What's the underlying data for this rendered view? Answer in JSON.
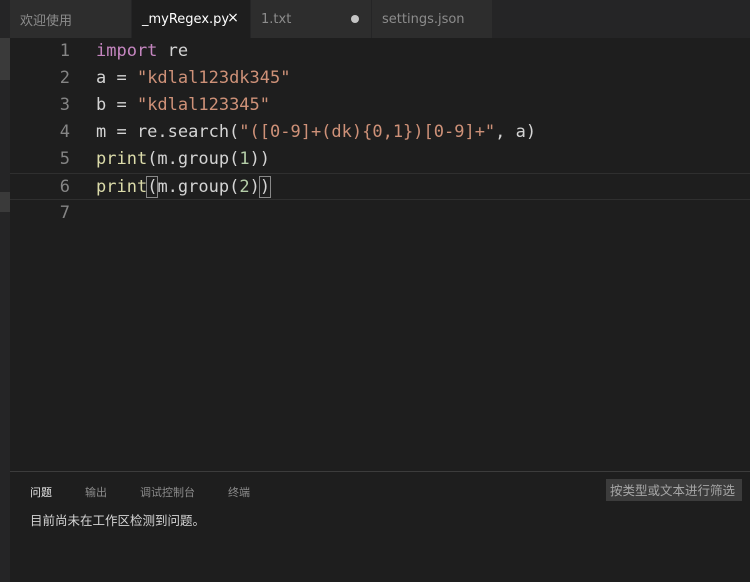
{
  "tabs": [
    {
      "label": "欢迎使用",
      "active": false
    },
    {
      "label": "_myRegex.py",
      "active": true,
      "close_icon": "×"
    },
    {
      "label": "1.txt",
      "active": false,
      "modified": true
    },
    {
      "label": "settings.json",
      "active": false
    }
  ],
  "editor": {
    "lines": [
      {
        "n": "1",
        "tokens": [
          {
            "t": "import",
            "c": "kw"
          },
          {
            "t": " re",
            "c": ""
          }
        ]
      },
      {
        "n": "2",
        "tokens": [
          {
            "t": "a = ",
            "c": ""
          },
          {
            "t": "\"kdlal123dk345\"",
            "c": "str"
          }
        ]
      },
      {
        "n": "3",
        "tokens": [
          {
            "t": "b = ",
            "c": ""
          },
          {
            "t": "\"kdlal123345\"",
            "c": "str"
          }
        ]
      },
      {
        "n": "4",
        "tokens": [
          {
            "t": "m = re.search(",
            "c": ""
          },
          {
            "t": "\"([0-9]+(dk){0,1})[0-9]+\"",
            "c": "str"
          },
          {
            "t": ", a)",
            "c": ""
          }
        ]
      },
      {
        "n": "5",
        "tokens": [
          {
            "t": "print",
            "c": "fn"
          },
          {
            "t": "(m.group(",
            "c": ""
          },
          {
            "t": "1",
            "c": "num"
          },
          {
            "t": "))",
            "c": ""
          }
        ]
      },
      {
        "n": "6",
        "tokens": [
          {
            "t": "print",
            "c": "fn"
          },
          {
            "t": "(",
            "c": "bracket"
          },
          {
            "t": "m.group(",
            "c": ""
          },
          {
            "t": "2",
            "c": "num"
          },
          {
            "t": ")",
            "c": ""
          },
          {
            "t": ")",
            "c": "bracket"
          }
        ]
      },
      {
        "n": "7",
        "tokens": []
      }
    ],
    "current_line": "6"
  },
  "panel": {
    "tabs": [
      "问题",
      "输出",
      "调试控制台",
      "终端"
    ],
    "active_tab": "问题",
    "filter_placeholder": "按类型或文本进行筛选",
    "message": "目前尚未在工作区检测到问题。"
  },
  "colors": {
    "background": "#1e1e1e",
    "keyword": "#c586c0",
    "function": "#dcdcaa",
    "string": "#ce9178",
    "number": "#b5cea8",
    "line_number": "#858585"
  }
}
